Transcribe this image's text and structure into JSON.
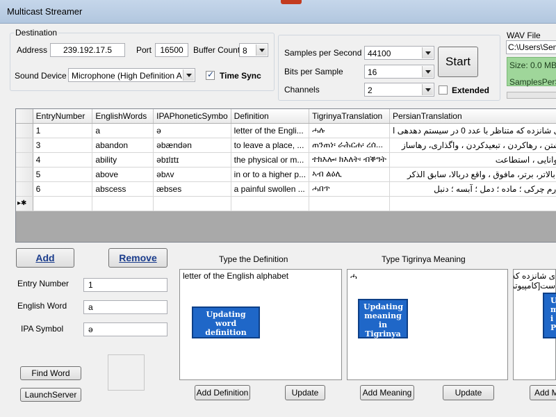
{
  "window": {
    "title": "Multicast Streamer"
  },
  "destination": {
    "group_label": "Destination",
    "address_label": "Address",
    "address_value": "239.192.17.5",
    "port_label": "Port",
    "port_value": "16500",
    "buffer_count_label": "Buffer Count",
    "buffer_count_value": "8",
    "sound_device_label": "Sound Device",
    "sound_device_value": "Microphone (High Definition Aud",
    "time_sync_label": "Time Sync",
    "time_sync_checked": true
  },
  "format": {
    "samples_label": "Samples per Second",
    "samples_value": "44100",
    "bits_label": "Bits per Sample",
    "bits_value": "16",
    "channels_label": "Channels",
    "channels_value": "2",
    "extended_label": "Extended",
    "extended_checked": false,
    "start_label": "Start"
  },
  "wav": {
    "group_label": "WAV File",
    "path_value": "C:\\Users\\Semi",
    "size_text": "Size: 0.0 MB",
    "samples_text": "SamplesPerSe"
  },
  "grid": {
    "columns": [
      "EntryNumber",
      "EnglishWords",
      "IPAPhoneticSymbo",
      "Definition",
      "TigrinyaTranslation",
      "PersianTranslation"
    ],
    "rows": [
      [
        "1",
        "a",
        "ə",
        "letter of the Engli...",
        "ሓሉ",
        "ی شانزده که متناظر با عدد 0 در سیستم دهدهی ا"
      ],
      [
        "3",
        "abandon",
        "əbændən",
        "to leave a place, ...",
        "ጠንጠነ፡ ራሕርሐ፡ ረሰ...",
        "شتن ، رهاکردن ، تبعیدکردن ، واگذاری، رهاساز"
      ],
      [
        "4",
        "ability",
        "əbɪlɪtɪ",
        "the physical or m...",
        "ተክእሎ፡ ክእለት፡ ብቕዓት",
        "توانایی ، استطاعت"
      ],
      [
        "5",
        "above",
        "əbʌv",
        "in or to a higher p...",
        "ኣብ ልዕሊ",
        "، بالاتر، برتر، مافوق ، واقع دربالا، سابق الذکر"
      ],
      [
        "6",
        "abscess",
        "æbses",
        "a painful swollen ...",
        "ሓበጥ",
        "ورم چرکی ؛ ماده ؛ دمل ؛ آبسه ؛ دنبل"
      ]
    ],
    "new_row_marker": "▸✱"
  },
  "editor": {
    "add_label": "Add",
    "remove_label": "Remove",
    "entry_number_label": "Entry Number",
    "entry_number_value": "1",
    "english_word_label": "English Word",
    "english_word_value": "a",
    "ipa_label": "IPA Symbol",
    "ipa_value": "ə",
    "find_word_label": "Find Word",
    "launch_server_label": "LaunchServer"
  },
  "definition_panel": {
    "heading": "Type the Definition",
    "text": "letter of the English alphabet",
    "callout": "Updating word definition",
    "add_definition_label": "Add Definition",
    "update_label": "Update"
  },
  "tigrinya_panel": {
    "heading": "Type Tigrinya Meaning",
    "text": "ሓ",
    "callout": "Updating meaning in Tigrinya",
    "add_meaning_label": "Add Meaning",
    "update_label": "Update"
  },
  "persian_panel": {
    "text": "ی شانزده که\nست[کامپیوتر",
    "callout": "U\nm\ni\nP",
    "add_label": "Add M"
  },
  "colors": {
    "callout_fill": "#1f67c8",
    "callout_border": "#0d3f87",
    "wav_panel": "#9fd69a",
    "link_button_text": "#1a3c8c"
  }
}
